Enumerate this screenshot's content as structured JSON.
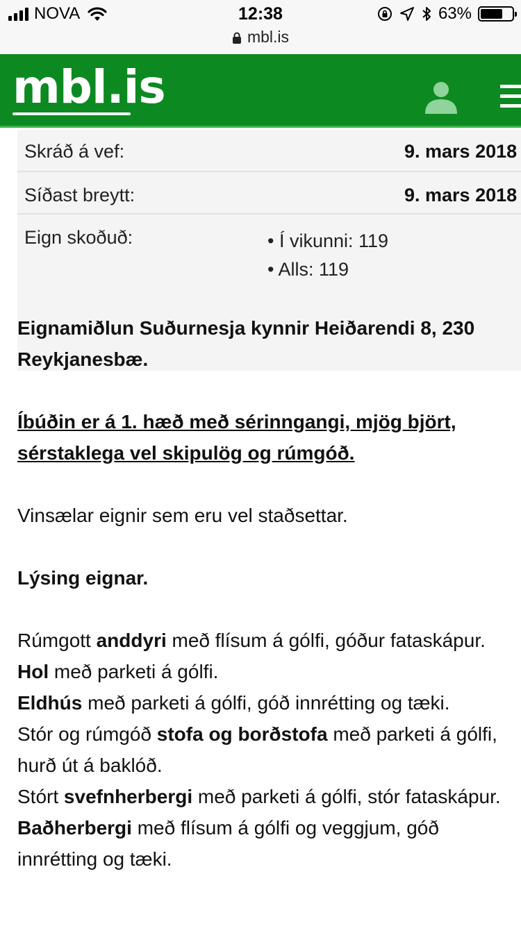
{
  "status_bar": {
    "carrier": "NOVA",
    "time": "12:38",
    "url": "mbl.is",
    "battery": "63%",
    "battery_level": 0.63,
    "icons": [
      "signal-icon",
      "wifi-icon",
      "orientation-lock-icon",
      "location-icon",
      "bluetooth-icon",
      "battery-icon"
    ]
  },
  "header": {
    "logo": "mbl.is",
    "background": "#0c8a21",
    "icons": [
      "user-icon",
      "menu-icon"
    ]
  },
  "info": {
    "rows": [
      {
        "label": "Skráð á vef:",
        "value": "9. mars 2018"
      },
      {
        "label": "Síðast breytt:",
        "value": "9. mars 2018"
      },
      {
        "label": "Eign skoðuð:",
        "items": [
          "Í vikunni: 119",
          "Alls: 119"
        ]
      }
    ]
  },
  "content": {
    "intro": "Eignamiðlun Suðurnesja kynnir Heiðarendi 8, 230 Reykjanesbæ.",
    "highlight": "Íbúðin er á 1. hæð með sérinngangi, mjög björt, sérstaklega vel skipulög og rúmgóð.",
    "tagline": "Vinsælar eignir sem eru vel staðsettar.",
    "section_title": "Lýsing eignar.",
    "lines": [
      {
        "pre": "Rúmgott ",
        "bold": "anddyri",
        "post": " með flísum á gólfi, góður fataskápur."
      },
      {
        "pre": "",
        "bold": "Hol",
        "post": " með parketi á gólfi."
      },
      {
        "pre": "",
        "bold": "Eldhús",
        "post": " með parketi á gólfi, góð innrétting og tæki."
      },
      {
        "pre": "Stór og rúmgóð ",
        "bold": "stofa og borðstofa",
        "post": " með parketi á gólfi, hurð út á baklóð."
      },
      {
        "pre": "Stórt ",
        "bold": "svefnherbergi",
        "post": " með parketi á gólfi, stór fataskápur."
      },
      {
        "pre": "",
        "bold": "Baðherbergi",
        "post": " með flísum á gólfi og veggjum, góð innrétting og tæki."
      }
    ]
  }
}
